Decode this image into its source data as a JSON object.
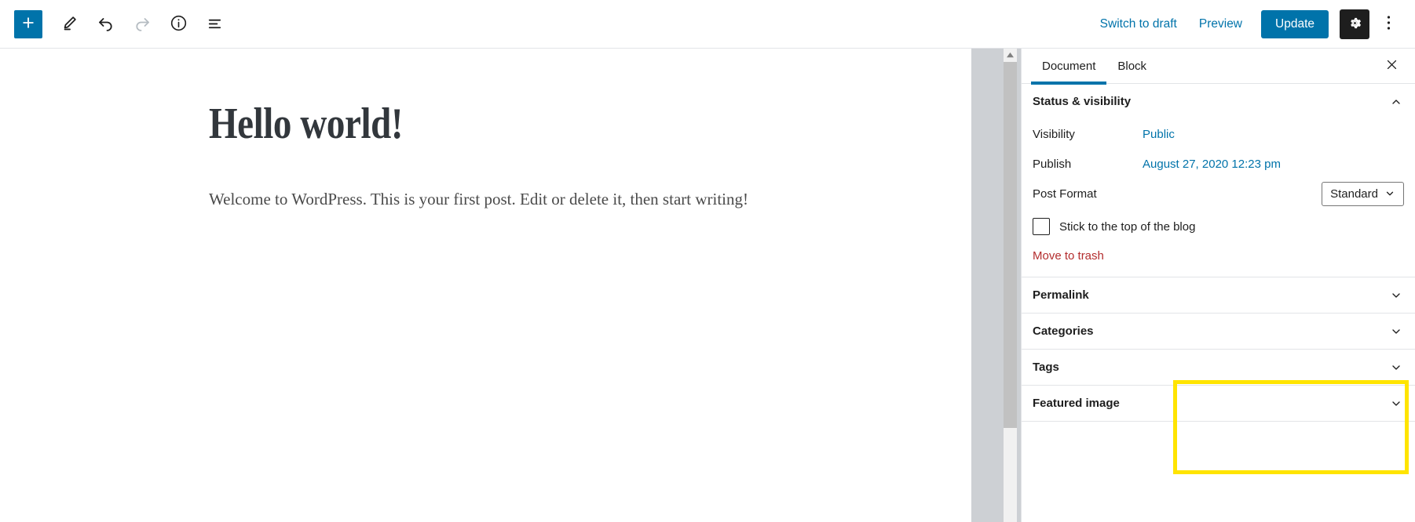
{
  "toolbar": {
    "left_items": [
      {
        "name": "block-inserter",
        "icon": "plus-icon",
        "label": "Add block"
      },
      {
        "name": "edit-mode",
        "icon": "pencil-icon",
        "label": "Tools"
      },
      {
        "name": "undo",
        "icon": "undo-arrow-icon",
        "label": "Undo"
      },
      {
        "name": "redo",
        "icon": "redo-arrow-icon",
        "label": "Redo",
        "disabled": true
      },
      {
        "name": "details",
        "icon": "info-circle-icon",
        "label": "Details"
      },
      {
        "name": "block-navigation",
        "icon": "list-view-icon",
        "label": "Block navigation"
      }
    ],
    "switch_to_draft_label": "Switch to draft",
    "preview_label": "Preview",
    "update_label": "Update",
    "settings_label": "Settings",
    "more_label": "More tools & options"
  },
  "editor": {
    "post_title": "Hello world!",
    "post_paragraph": "Welcome to WordPress. This is your first post. Edit or delete it, then start writing!"
  },
  "sidebar": {
    "tabs": [
      {
        "label": "Document",
        "active": true
      },
      {
        "label": "Block",
        "active": false
      }
    ],
    "close_label": "Close settings",
    "panels": [
      {
        "title": "Status & visibility",
        "expanded": true
      },
      {
        "title": "Permalink",
        "expanded": false
      },
      {
        "title": "Categories",
        "expanded": false
      },
      {
        "title": "Tags",
        "expanded": false
      },
      {
        "title": "Featured image",
        "expanded": false
      }
    ],
    "status": {
      "visibility_label": "Visibility",
      "visibility_value": "Public",
      "publish_label": "Publish",
      "publish_value": "August 27, 2020 12:23 pm",
      "post_format_label": "Post Format",
      "post_format_value": "Standard",
      "sticky_label": "Stick to the top of the blog",
      "sticky_checked": false,
      "move_to_trash_label": "Move to trash"
    }
  },
  "annotation": {
    "highlight_color": "#ffe400",
    "highlight_target": "categories-and-tags-panels"
  },
  "colors": {
    "accent": "#0073aa",
    "danger": "#b32d2e",
    "canvas_gutter": "#cdd0d4",
    "border": "#e2e4e7",
    "text": "#1e1e1e"
  }
}
